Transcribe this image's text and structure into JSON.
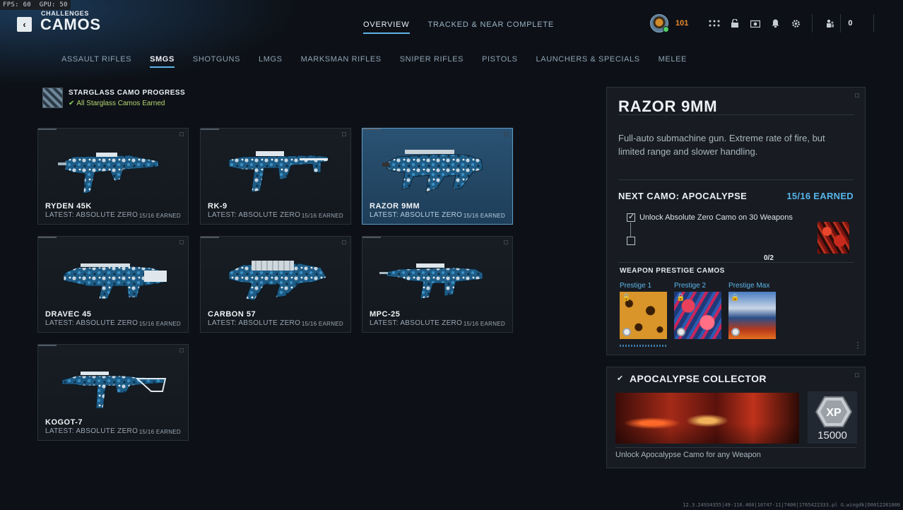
{
  "perf": {
    "fps_label": "FPS:",
    "fps": "60",
    "gpu_label": "GPU:",
    "gpu": "50"
  },
  "header": {
    "back_label": "‹",
    "subtitle": "CHALLENGES",
    "title": "CAMOS",
    "tabs": [
      {
        "label": "OVERVIEW",
        "active": true
      },
      {
        "label": "TRACKED & NEAR COMPLETE",
        "active": false
      }
    ],
    "rank": "101",
    "currency": "0"
  },
  "categories": [
    {
      "label": "ASSAULT RIFLES",
      "active": false
    },
    {
      "label": "SMGS",
      "active": true
    },
    {
      "label": "SHOTGUNS",
      "active": false
    },
    {
      "label": "LMGS",
      "active": false
    },
    {
      "label": "MARKSMAN RIFLES",
      "active": false
    },
    {
      "label": "SNIPER RIFLES",
      "active": false
    },
    {
      "label": "PISTOLS",
      "active": false
    },
    {
      "label": "LAUNCHERS & SPECIALS",
      "active": false
    },
    {
      "label": "MELEE",
      "active": false
    }
  ],
  "starglass": {
    "title": "STARGLASS CAMO PROGRESS",
    "status": "All Starglass Camos Earned"
  },
  "weapons": [
    {
      "name": "RYDEN 45K",
      "latest": "LATEST: ABSOLUTE ZERO",
      "earned": "15/16 EARNED",
      "selected": false
    },
    {
      "name": "RK-9",
      "latest": "LATEST: ABSOLUTE ZERO",
      "earned": "15/16 EARNED",
      "selected": false
    },
    {
      "name": "RAZOR 9MM",
      "latest": "LATEST: ABSOLUTE ZERO",
      "earned": "15/16 EARNED",
      "selected": true
    },
    {
      "name": "DRAVEC 45",
      "latest": "LATEST: ABSOLUTE ZERO",
      "earned": "15/16 EARNED",
      "selected": false
    },
    {
      "name": "CARBON 57",
      "latest": "LATEST: ABSOLUTE ZERO",
      "earned": "15/16 EARNED",
      "selected": false
    },
    {
      "name": "MPC-25",
      "latest": "LATEST: ABSOLUTE ZERO",
      "earned": "15/16 EARNED",
      "selected": false
    },
    {
      "name": "KOGOT-7",
      "latest": "LATEST: ABSOLUTE ZERO",
      "earned": "15/16 EARNED",
      "selected": false
    }
  ],
  "detail": {
    "title": "RAZOR 9MM",
    "description": "Full-auto submachine gun. Extreme rate of fire, but limited range and slower handling.",
    "next_camo": "NEXT CAMO: APOCALYPSE",
    "earned": "15/16 EARNED",
    "requirement": "Unlock Absolute Zero Camo on 30 Weapons",
    "progress": "0/2",
    "prestige_title": "WEAPON PRESTIGE CAMOS",
    "prestige": [
      {
        "label": "Prestige 1"
      },
      {
        "label": "Prestige 2"
      },
      {
        "label": "Prestige Max"
      }
    ]
  },
  "collector": {
    "title": "APOCALYPSE COLLECTOR",
    "xp_badge": "XP",
    "xp": "15000",
    "description": "Unlock Apocalypse Camo for any Weapon"
  },
  "debug": "12.3.24934355|49-116.460|10747-11|7400|1765422333.pl G.wingdk|D0012281000",
  "colors": {
    "accent": "#5cb3e8",
    "rank": "#f08a2e",
    "success": "#b6d672",
    "selected_card": "#2a5273"
  }
}
